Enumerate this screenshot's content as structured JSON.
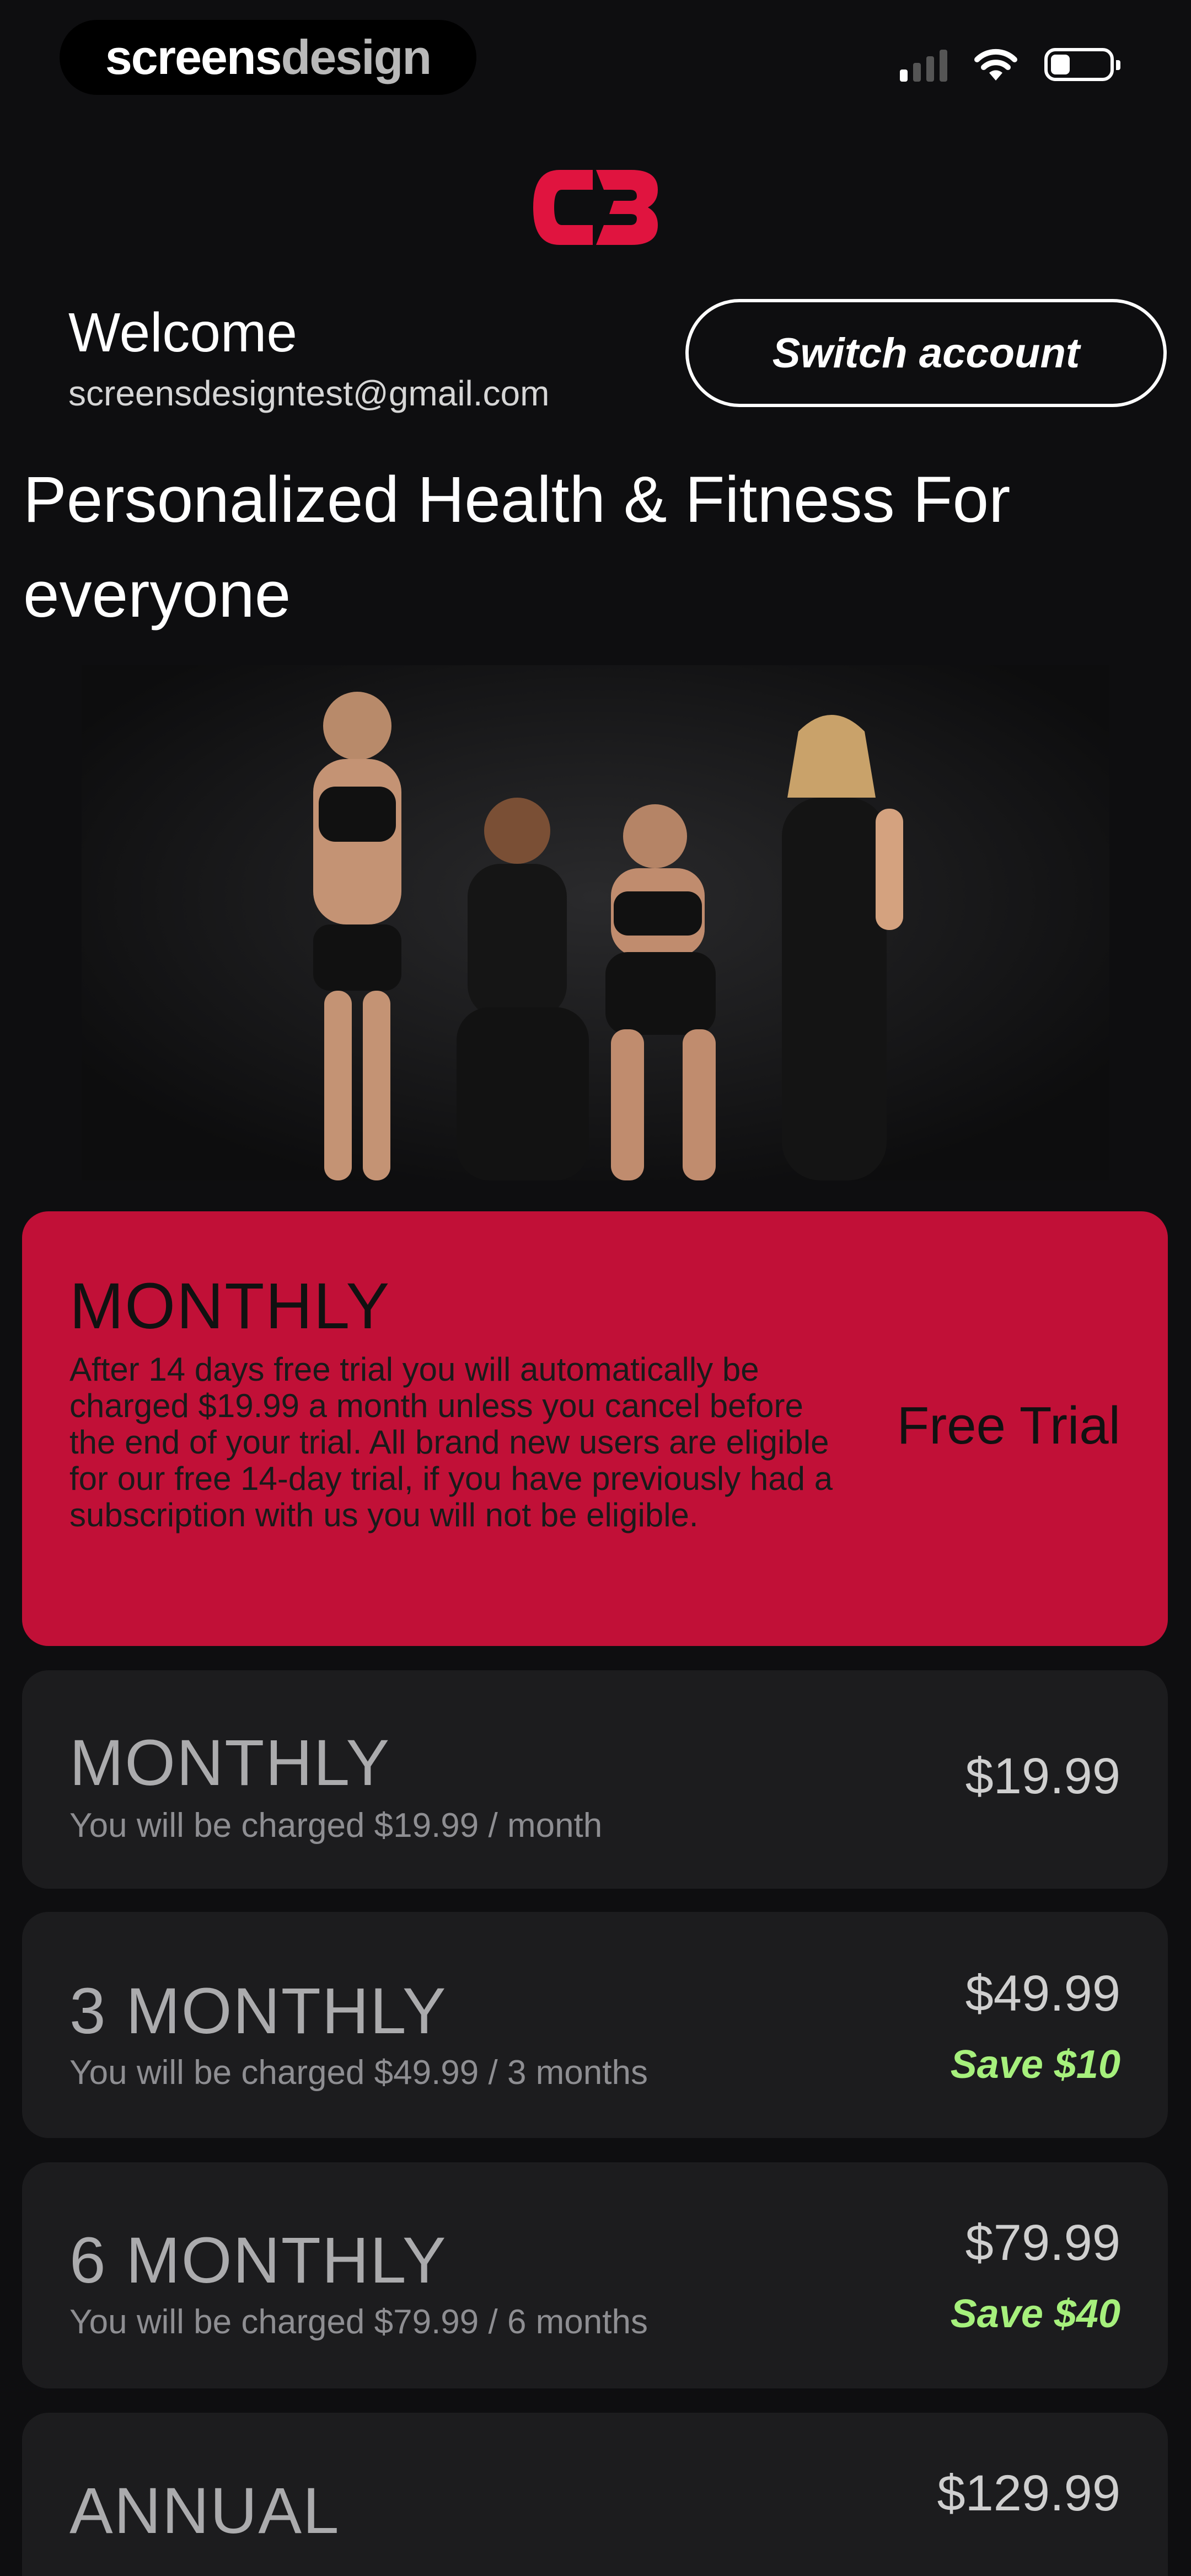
{
  "status_bar": {
    "brand_part1": "screens",
    "brand_part2": "design"
  },
  "header": {
    "welcome": "Welcome",
    "email": "screensdesigntest@gmail.com",
    "switch_account": "Switch account"
  },
  "headline": "Personalized Health & Fitness For everyone",
  "plans": [
    {
      "name": "MONTHLY",
      "description": "After 14 days free trial you will automatically be charged $19.99 a month unless you cancel before the end of your trial.  All brand new users are eligible for our free 14-day trial, if you have previously had a subscription with us you will not be eligible.",
      "price": "Free Trial",
      "save": ""
    },
    {
      "name": "MONTHLY",
      "description": "You will be charged $19.99 / month",
      "price": "$19.99",
      "save": ""
    },
    {
      "name": "3 MONTHLY",
      "description": "You will be charged $49.99 / 3 months",
      "price": "$49.99",
      "save": "Save $10"
    },
    {
      "name": "6 MONTHLY",
      "description": "You will be charged $79.99 / 6 months",
      "price": "$79.99",
      "save": "Save $40"
    },
    {
      "name": "ANNUAL",
      "description": "",
      "price": "$129.99",
      "save": ""
    }
  ],
  "colors": {
    "accent": "#c11037",
    "save_green": "#a6f07c",
    "background": "#0e0e10",
    "card": "#1c1c1e"
  }
}
